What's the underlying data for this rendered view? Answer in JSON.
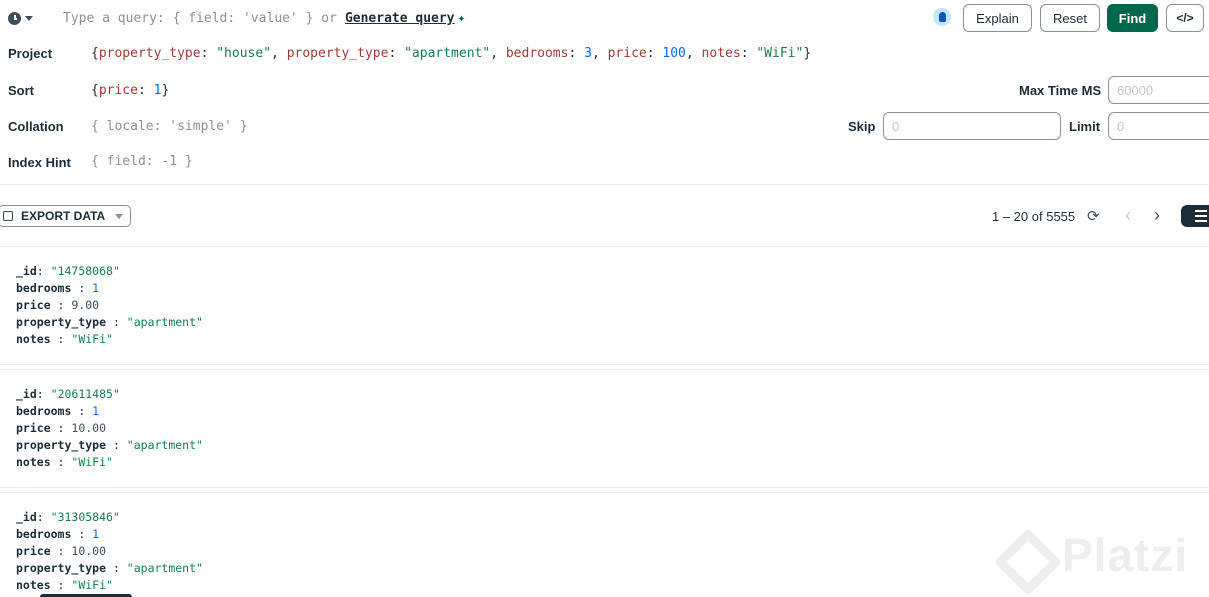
{
  "query_bar": {
    "history_icon": "clock-icon",
    "filter_placeholder": "Type a query: { field: 'value' } or",
    "generate_query_label": "Generate query",
    "generate_query_icon": "sparkle-icon",
    "insight_icon": "lightbulb-icon",
    "buttons": {
      "explain": "Explain",
      "reset": "Reset",
      "find": "Find",
      "code": "</>"
    }
  },
  "options": {
    "project": {
      "label": "Project",
      "tokens": [
        {
          "t": "{",
          "c": "p"
        },
        {
          "t": "property_type",
          "c": "k"
        },
        {
          "t": ": ",
          "c": "p"
        },
        {
          "t": "\"house\"",
          "c": "s"
        },
        {
          "t": ", ",
          "c": "p"
        },
        {
          "t": "property_type",
          "c": "k"
        },
        {
          "t": ": ",
          "c": "p"
        },
        {
          "t": "\"apartment\"",
          "c": "s"
        },
        {
          "t": ", ",
          "c": "p"
        },
        {
          "t": "bedrooms",
          "c": "k"
        },
        {
          "t": ": ",
          "c": "p"
        },
        {
          "t": "3",
          "c": "n"
        },
        {
          "t": ", ",
          "c": "p"
        },
        {
          "t": "price",
          "c": "k"
        },
        {
          "t": ": ",
          "c": "p"
        },
        {
          "t": "100",
          "c": "n"
        },
        {
          "t": ", ",
          "c": "p"
        },
        {
          "t": "notes",
          "c": "k"
        },
        {
          "t": ": ",
          "c": "p"
        },
        {
          "t": "\"WiFi\"",
          "c": "s"
        },
        {
          "t": "}",
          "c": "p"
        }
      ]
    },
    "sort": {
      "label": "Sort",
      "tokens": [
        {
          "t": "{",
          "c": "p"
        },
        {
          "t": "price",
          "c": "k"
        },
        {
          "t": ": ",
          "c": "p"
        },
        {
          "t": "1",
          "c": "n"
        },
        {
          "t": "}",
          "c": "p"
        }
      ]
    },
    "collation": {
      "label": "Collation",
      "placeholder": "{ locale: 'simple' }"
    },
    "index_hint": {
      "label": "Index Hint",
      "placeholder": "{ field: -1 }"
    },
    "max_time_ms": {
      "label": "Max Time MS",
      "placeholder": "60000"
    },
    "skip": {
      "label": "Skip",
      "placeholder": "0"
    },
    "limit": {
      "label": "Limit",
      "placeholder": "0"
    }
  },
  "results_toolbar": {
    "export_label": "EXPORT DATA",
    "export_icon": "export-icon",
    "pagination_text": "1 – 20 of 5555",
    "refresh_icon": "refresh-icon",
    "prev_icon": "chevron-left-icon",
    "next_icon": "chevron-right-icon",
    "view_icon": "list-view-icon"
  },
  "documents": [
    {
      "fields": [
        {
          "key": "_id",
          "sep": ":",
          "value": "\"14758068\"",
          "type": "str"
        },
        {
          "key": "bedrooms",
          "sep": " :",
          "value": "1",
          "type": "num"
        },
        {
          "key": "price",
          "sep": " :",
          "value": "9.00",
          "type": "dec"
        },
        {
          "key": "property_type",
          "sep": " :",
          "value": "\"apartment\"",
          "type": "str"
        },
        {
          "key": "notes",
          "sep": " :",
          "value": "\"WiFi\"",
          "type": "str"
        }
      ]
    },
    {
      "fields": [
        {
          "key": "_id",
          "sep": ":",
          "value": "\"20611485\"",
          "type": "str"
        },
        {
          "key": "bedrooms",
          "sep": " :",
          "value": "1",
          "type": "num"
        },
        {
          "key": "price",
          "sep": " :",
          "value": "10.00",
          "type": "dec"
        },
        {
          "key": "property_type",
          "sep": " :",
          "value": "\"apartment\"",
          "type": "str"
        },
        {
          "key": "notes",
          "sep": " :",
          "value": "\"WiFi\"",
          "type": "str"
        }
      ]
    },
    {
      "fields": [
        {
          "key": "_id",
          "sep": ":",
          "value": "\"31305846\"",
          "type": "str"
        },
        {
          "key": "bedrooms",
          "sep": " :",
          "value": "1",
          "type": "num"
        },
        {
          "key": "price",
          "sep": " :",
          "value": "10.00",
          "type": "dec"
        },
        {
          "key": "property_type",
          "sep": " :",
          "value": "\"apartment\"",
          "type": "str"
        },
        {
          "key": "notes",
          "sep": " :",
          "value": "\"WiFi\"",
          "type": "str"
        }
      ]
    }
  ],
  "watermark": {
    "text": "Platzi",
    "icon": "platzi-logo-icon"
  },
  "colors": {
    "primary_green": "#00684a",
    "key_red": "#a33a35",
    "string_green": "#12824d",
    "number_blue": "#016bf8"
  }
}
